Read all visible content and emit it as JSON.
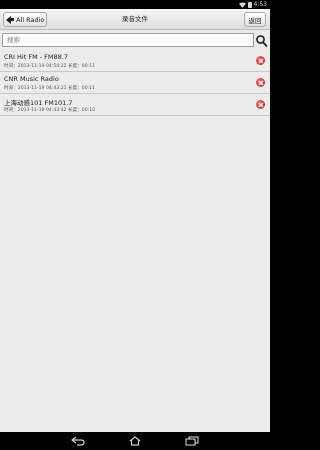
{
  "status_bar": {
    "time": "4:53"
  },
  "header": {
    "back_label": "All Radio",
    "title": "录音文件",
    "return_label": "返回"
  },
  "search": {
    "placeholder": "搜索",
    "value": ""
  },
  "recordings": [
    {
      "name": "CRI Hit FM - FM88.7",
      "meta": "时间：2013-11-19 04:54:22  长度：00:11"
    },
    {
      "name": "CNR Music Radio",
      "meta": "时间：2013-11-19 04:43:21  长度：00:11"
    },
    {
      "name": "上海动感101 FM101.7",
      "meta": "时间：2013-11-19 04:43:42  长度：00:10"
    }
  ],
  "colors": {
    "background": "#ececec",
    "delete": "#d10f0f"
  },
  "icons": [
    "wifi-icon",
    "battery-icon",
    "back-arrow-icon",
    "search-icon",
    "delete-icon",
    "nav-back-icon",
    "nav-home-icon",
    "nav-recents-icon"
  ]
}
